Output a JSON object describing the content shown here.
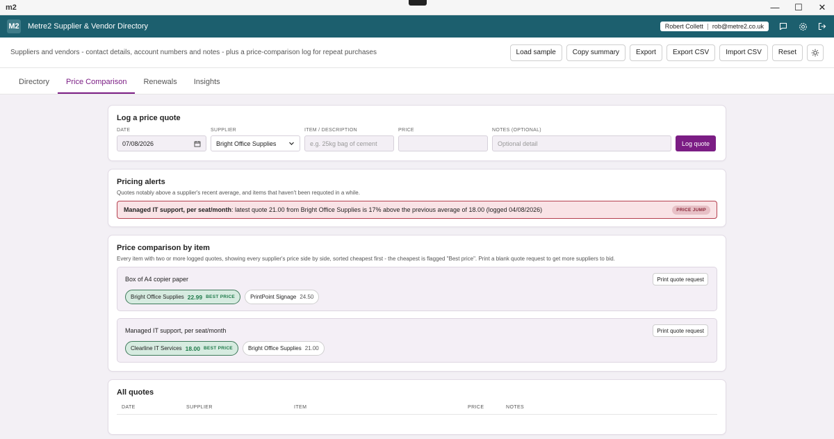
{
  "os": {
    "logo": "m2",
    "minimize": "—",
    "maximize": "☐",
    "close": "✕"
  },
  "app": {
    "logo_text": "M2",
    "title": "Metre2 Supplier & Vendor Directory",
    "user_name": "Robert Collett",
    "user_email": "rob@metre2.co.uk"
  },
  "subheader": {
    "description": "Suppliers and vendors - contact details, account numbers and notes - plus a price-comparison log for repeat purchases",
    "buttons": [
      "Load sample",
      "Copy summary",
      "Export",
      "Export CSV",
      "Import CSV",
      "Reset"
    ]
  },
  "tabs": [
    {
      "label": "Directory",
      "active": false
    },
    {
      "label": "Price Comparison",
      "active": true
    },
    {
      "label": "Renewals",
      "active": false
    },
    {
      "label": "Insights",
      "active": false
    }
  ],
  "quote_form": {
    "title": "Log a price quote",
    "date_label": "DATE",
    "date_value": "07/08/2026",
    "supplier_label": "SUPPLIER",
    "supplier_value": "Bright Office Supplies",
    "item_label": "ITEM / DESCRIPTION",
    "item_placeholder": "e.g. 25kg bag of cement",
    "price_label": "PRICE",
    "price_value": "",
    "notes_label": "NOTES (OPTIONAL)",
    "notes_placeholder": "Optional detail",
    "submit_label": "Log quote"
  },
  "alerts": {
    "title": "Pricing alerts",
    "description": "Quotes notably above a supplier's recent average, and items that haven't been requoted in a while.",
    "item": {
      "subject": "Managed IT support, per seat/month",
      "message": ": latest quote 21.00 from Bright Office Supplies is 17% above the previous average of 18.00 (logged 04/08/2026)",
      "badge": "PRICE JUMP"
    }
  },
  "comparison": {
    "title": "Price comparison by item",
    "description": "Every item with two or more logged quotes, showing every supplier's price side by side, sorted cheapest first - the cheapest is flagged \"Best price\". Print a blank quote request to get more suppliers to bid.",
    "print_label": "Print quote request",
    "best_label": "BEST PRICE",
    "items": [
      {
        "name": "Box of A4 copier paper",
        "quotes": [
          {
            "supplier": "Bright Office Supplies",
            "price": "22.99",
            "best": true
          },
          {
            "supplier": "PrintPoint Signage",
            "price": "24.50",
            "best": false
          }
        ]
      },
      {
        "name": "Managed IT support, per seat/month",
        "quotes": [
          {
            "supplier": "Clearline IT Services",
            "price": "18.00",
            "best": true
          },
          {
            "supplier": "Bright Office Supplies",
            "price": "21.00",
            "best": false
          }
        ]
      }
    ]
  },
  "all_quotes": {
    "title": "All quotes",
    "columns": [
      "DATE",
      "SUPPLIER",
      "ITEM",
      "PRICE",
      "NOTES"
    ]
  }
}
